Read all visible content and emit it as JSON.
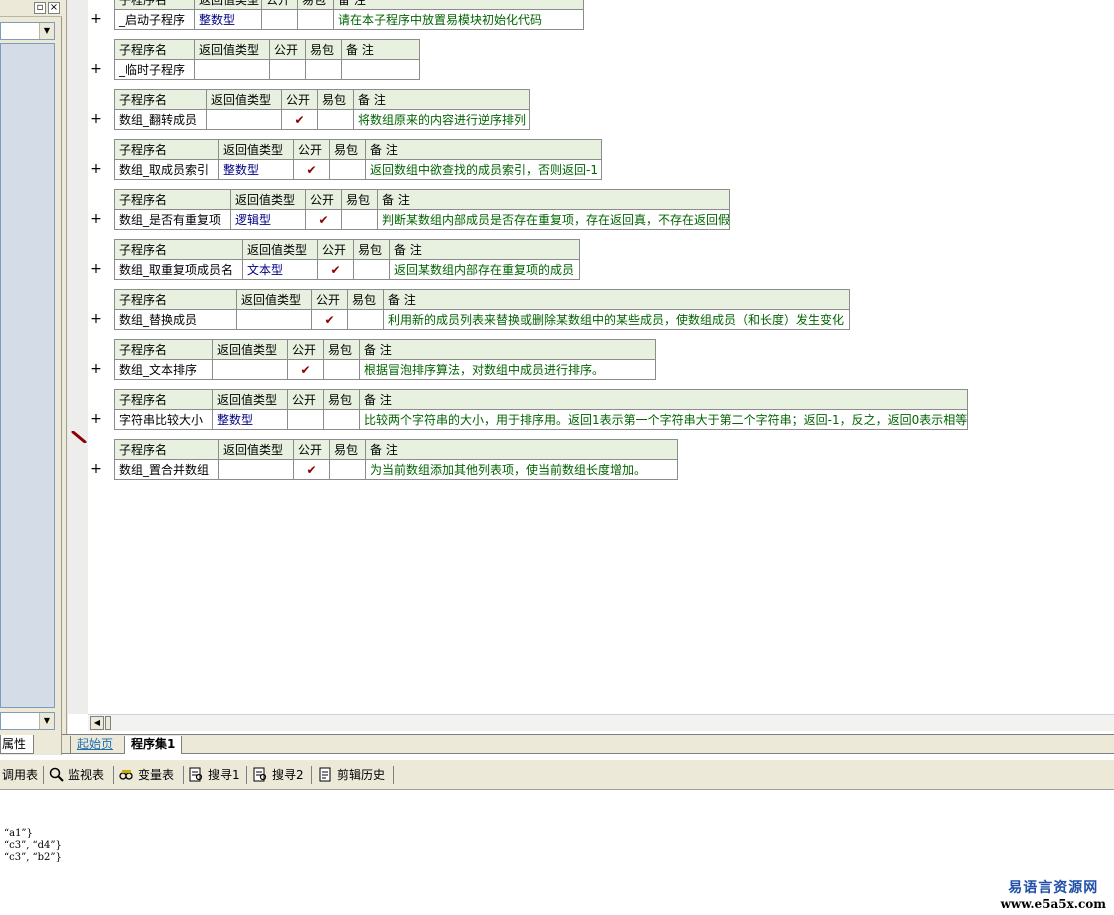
{
  "left_panel": {
    "tab_label": "属性"
  },
  "editor_tabs": [
    {
      "label": "起始页"
    },
    {
      "label": "程序集1"
    }
  ],
  "table_headers": {
    "name": "子程序名",
    "return_type": "返回值类型",
    "public": "公开",
    "easy_pack": "易包",
    "note": "备 注"
  },
  "subroutines": [
    {
      "name": "_启动子程序",
      "return_type": "整数型",
      "public": false,
      "note": "请在本子程序中放置易模块初始化代码"
    },
    {
      "name": "_临时子程序",
      "return_type": "",
      "public": false,
      "note": ""
    },
    {
      "name": "数组_翻转成员",
      "return_type": "",
      "public": true,
      "note": "将数组原来的内容进行逆序排列"
    },
    {
      "name": "数组_取成员索引",
      "return_type": "整数型",
      "public": true,
      "note": "返回数组中欲查找的成员索引，否则返回-1"
    },
    {
      "name": "数组_是否有重复项",
      "return_type": "逻辑型",
      "public": true,
      "note": "判断某数组内部成员是否存在重复项，存在返回真，不存在返回假"
    },
    {
      "name": "数组_取重复项成员名",
      "return_type": "文本型",
      "public": true,
      "note": "返回某数组内部存在重复项的成员"
    },
    {
      "name": "数组_替换成员",
      "return_type": "",
      "public": true,
      "note": "利用新的成员列表来替换或删除某数组中的某些成员，使数组成员（和长度）发生变化"
    },
    {
      "name": "数组_文本排序",
      "return_type": "",
      "public": true,
      "note": "根据冒泡排序算法，对数组中成员进行排序。"
    },
    {
      "name": "字符串比较大小",
      "return_type": "整数型",
      "public": false,
      "note": "比较两个字符串的大小，用于排序用。返回1表示第一个字符串大于第二个字符串；返回-1，反之，返回0表示相等"
    },
    {
      "name": "数组_置合并数组",
      "return_type": "",
      "public": true,
      "note": "为当前数组添加其他列表项，使当前数组长度增加。"
    }
  ],
  "check_glyph": "✔",
  "expand_glyph": "+",
  "toolbar": [
    {
      "label": "调用表",
      "icon": "call-table-icon"
    },
    {
      "label": "监视表",
      "icon": "magnifier-icon"
    },
    {
      "label": "变量表",
      "icon": "variables-icon"
    },
    {
      "label": "搜寻1",
      "icon": "search-1-icon"
    },
    {
      "label": "搜寻2",
      "icon": "search-2-icon"
    },
    {
      "label": "剪辑历史",
      "icon": "clip-history-icon"
    }
  ],
  "output_lines": [
    "“a1”}",
    "“c3”, “d4”}",
    "“c3”, “b2”}"
  ],
  "watermark": {
    "line1": "易语言资源网",
    "line2": "www.e5a5x.com"
  }
}
